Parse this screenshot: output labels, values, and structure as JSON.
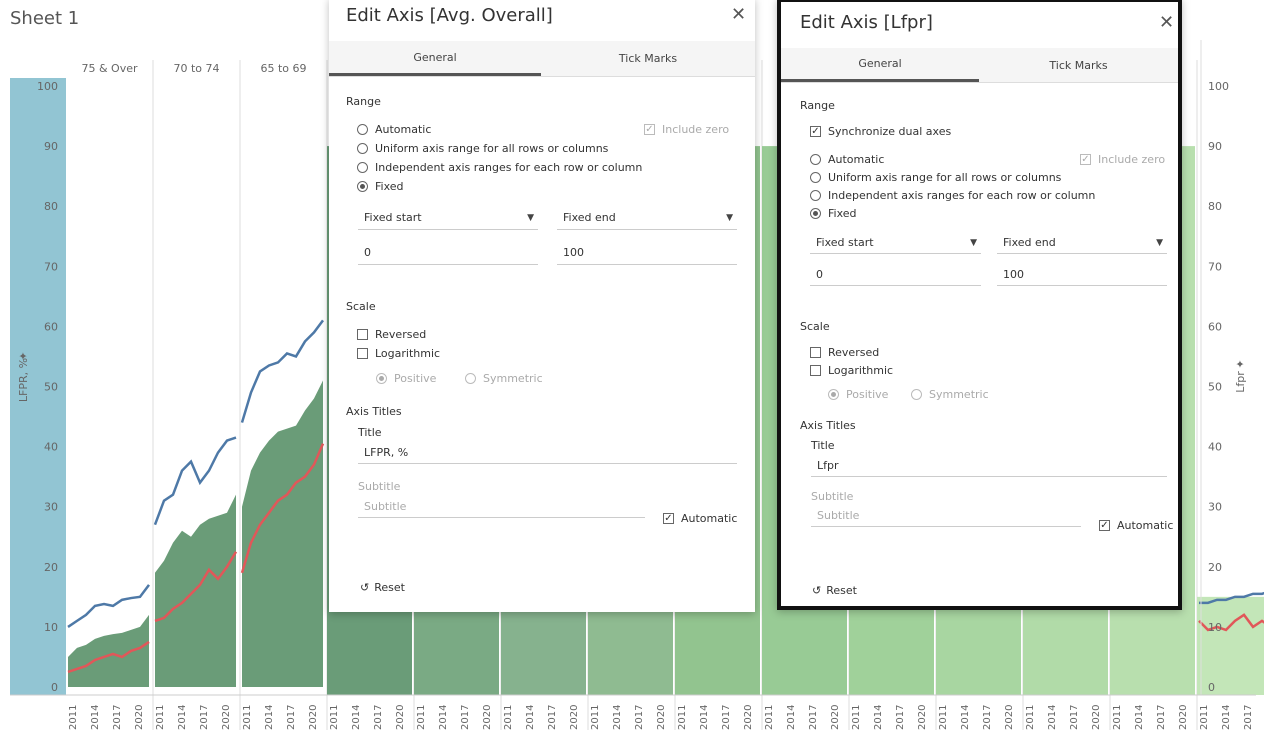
{
  "sheet": {
    "title": "Sheet 1"
  },
  "colors": {
    "blue_line": "#4e79a7",
    "red_line": "#e15759",
    "panel_fills": [
      "#6a9c78",
      "#6a9c78",
      "#6a9c78",
      "#6a9c78",
      "#7aaa84",
      "#86b28e",
      "#8fbb91",
      "#92c48f",
      "#98cb95",
      "#a0d19a",
      "#a8d6a1",
      "#b1dba8",
      "#b8dfae",
      "#c3e6b8"
    ],
    "side_bar": "#92c5d3"
  },
  "chart": {
    "left_axis_title": "LFPR, %",
    "right_axis_title": "Lfpr",
    "left_ticks": [
      "0",
      "10",
      "20",
      "30",
      "40",
      "50",
      "60",
      "70",
      "80",
      "90",
      "100"
    ],
    "right_ticks": [
      "0",
      "10",
      "20",
      "30",
      "40",
      "50",
      "60",
      "70",
      "80",
      "90",
      "100"
    ],
    "panel_headers": [
      "75 & Over",
      "70 to 74",
      "65 to 69"
    ],
    "year_labels": [
      "2011",
      "2014",
      "2017",
      "2020"
    ]
  },
  "chart_data": {
    "type": "area",
    "ylim": [
      0,
      100
    ],
    "x": [
      2011,
      2012,
      2013,
      2014,
      2015,
      2016,
      2017,
      2018,
      2019,
      2020
    ],
    "panels": [
      {
        "header": "75 & Over",
        "area": [
          5,
          6.5,
          7,
          8,
          8.5,
          8.8,
          9,
          9.5,
          10,
          12
        ],
        "blue": [
          10,
          11,
          12,
          13.5,
          13.8,
          13.5,
          14.5,
          14.8,
          15,
          17
        ],
        "red": [
          2.5,
          3,
          3.5,
          4.5,
          5,
          5.5,
          5,
          6,
          6.5,
          7.5
        ]
      },
      {
        "header": "70 to 74",
        "area": [
          19,
          21,
          24,
          26,
          25,
          27,
          28,
          28.5,
          29,
          32
        ],
        "blue": [
          27,
          31,
          32,
          36,
          37.5,
          34,
          36,
          39,
          41,
          41.5
        ],
        "red": [
          11,
          11.5,
          13,
          14,
          15.5,
          17,
          19.5,
          18,
          20,
          22.5
        ]
      },
      {
        "header": "65 to 69",
        "area": [
          30,
          36,
          39,
          41,
          42.5,
          43,
          43.5,
          46,
          48,
          51
        ],
        "blue": [
          44,
          49,
          52.5,
          53.5,
          54,
          55.5,
          55,
          57.5,
          59,
          61
        ],
        "red": [
          19,
          24,
          27,
          29,
          31,
          32,
          34,
          35,
          37,
          40.5
        ]
      }
    ],
    "last_panel": {
      "area": [
        15,
        15,
        15,
        15,
        15,
        15,
        15,
        15,
        15,
        15
      ],
      "blue": [
        14,
        14,
        14.5,
        14.5,
        15,
        15,
        15.5,
        15.5,
        16,
        17.5
      ],
      "red": [
        11,
        9.5,
        10,
        9.5,
        11,
        12,
        10,
        11,
        10,
        13.5
      ]
    }
  },
  "dialog_overall": {
    "title": "Edit Axis [Avg. Overall]",
    "tabs": [
      "General",
      "Tick Marks"
    ],
    "range_label": "Range",
    "options": [
      "Automatic",
      "Uniform axis range for all rows or columns",
      "Independent axis ranges for each row or column",
      "Fixed"
    ],
    "include_zero": "Include zero",
    "fixed_start_label": "Fixed start",
    "fixed_end_label": "Fixed end",
    "start_value": "0",
    "end_value": "100",
    "scale_label": "Scale",
    "reversed": "Reversed",
    "logarithmic": "Logarithmic",
    "positive": "Positive",
    "symmetric": "Symmetric",
    "axis_titles_label": "Axis Titles",
    "title_label": "Title",
    "title_value": "LFPR, %",
    "subtitle_label": "Subtitle",
    "subtitle_placeholder": "Subtitle",
    "automatic": "Automatic",
    "reset": "Reset"
  },
  "dialog_lfpr": {
    "title": "Edit Axis [Lfpr]",
    "tabs": [
      "General",
      "Tick Marks"
    ],
    "range_label": "Range",
    "sync": "Synchronize dual axes",
    "options": [
      "Automatic",
      "Uniform axis range for all rows or columns",
      "Independent axis ranges for each row or column",
      "Fixed"
    ],
    "include_zero": "Include zero",
    "fixed_start_label": "Fixed start",
    "fixed_end_label": "Fixed end",
    "start_value": "0",
    "end_value": "100",
    "scale_label": "Scale",
    "reversed": "Reversed",
    "logarithmic": "Logarithmic",
    "positive": "Positive",
    "symmetric": "Symmetric",
    "axis_titles_label": "Axis Titles",
    "title_label": "Title",
    "title_value": "Lfpr",
    "subtitle_label": "Subtitle",
    "subtitle_placeholder": "Subtitle",
    "automatic": "Automatic",
    "reset": "Reset"
  }
}
